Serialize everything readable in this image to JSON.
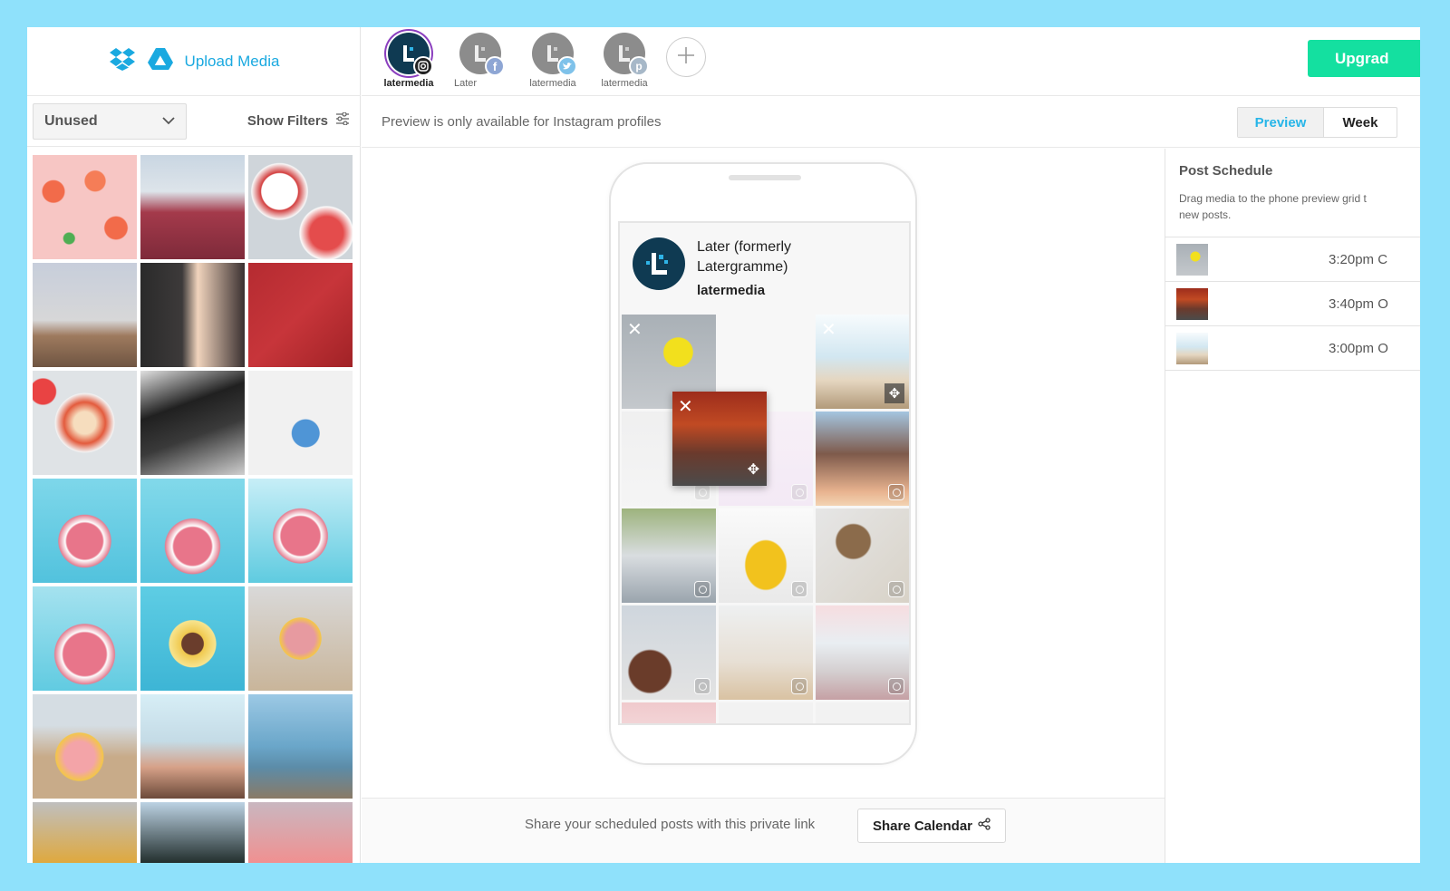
{
  "sidebar": {
    "upload_label": "Upload Media",
    "filter_select": "Unused",
    "show_filters_label": "Show Filters",
    "media_count": 21
  },
  "profiles": [
    {
      "name": "latermedia",
      "network": "instagram",
      "active": true
    },
    {
      "name": "Later",
      "network": "facebook",
      "active": false
    },
    {
      "name": "latermedia",
      "network": "twitter",
      "active": false
    },
    {
      "name": "latermedia",
      "network": "pinterest",
      "active": false
    }
  ],
  "topbar": {
    "add_profile_icon": "plus-icon",
    "upgrade_label": "Upgrad"
  },
  "subheader": {
    "note": "Preview is only available for Instagram profiles",
    "toggle": {
      "preview": "Preview",
      "week": "Week"
    }
  },
  "preview": {
    "display_name": "Later (formerly Latergramme)",
    "handle": "latermedia"
  },
  "schedule": {
    "title": "Post Schedule",
    "description_line1": "Drag media to the phone preview grid t",
    "description_line2": "new posts.",
    "items": [
      {
        "time": "3:20pm C"
      },
      {
        "time": "3:40pm O"
      },
      {
        "time": "3:00pm O"
      }
    ]
  },
  "footer": {
    "text": "Share your scheduled posts with this private link",
    "share_label": "Share Calendar"
  },
  "colors": {
    "accent_blue": "#1aa9e0",
    "upgrade_green": "#14e0a0",
    "page_border": "#8fe1fb"
  }
}
